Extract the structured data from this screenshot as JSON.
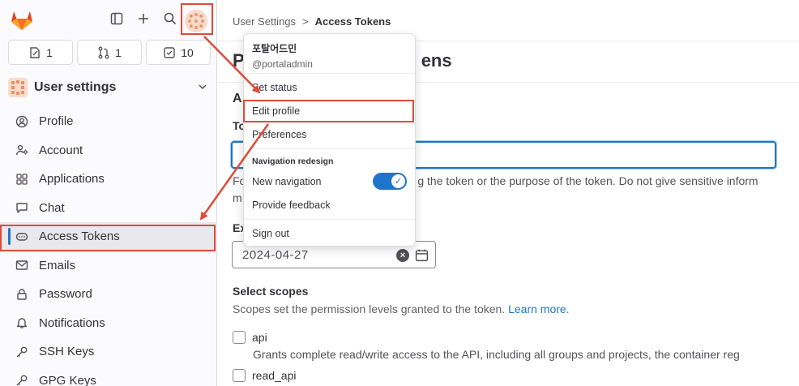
{
  "sidebar": {
    "counters": [
      {
        "icon": "issues-icon",
        "count": "1"
      },
      {
        "icon": "merge-request-icon",
        "count": "1"
      },
      {
        "icon": "todo-icon",
        "count": "10"
      }
    ],
    "section_title": "User settings",
    "items": [
      {
        "label": "Profile",
        "icon": "profile-icon"
      },
      {
        "label": "Account",
        "icon": "account-icon"
      },
      {
        "label": "Applications",
        "icon": "applications-icon"
      },
      {
        "label": "Chat",
        "icon": "chat-icon"
      },
      {
        "label": "Access Tokens",
        "icon": "token-icon",
        "active": true
      },
      {
        "label": "Emails",
        "icon": "mail-icon"
      },
      {
        "label": "Password",
        "icon": "lock-icon"
      },
      {
        "label": "Notifications",
        "icon": "bell-icon"
      },
      {
        "label": "SSH Keys",
        "icon": "key-icon"
      },
      {
        "label": "GPG Keys",
        "icon": "key-icon"
      }
    ]
  },
  "breadcrumb": {
    "parent": "User Settings",
    "separator": ">",
    "current": "Access Tokens"
  },
  "main": {
    "title_left": "P",
    "title_right": "ens",
    "subtitle_left": "A",
    "token_label": "To",
    "help_line1_left": "Fo",
    "help_line1_right": "g the token or the purpose of the token. Do not give sensitive inform",
    "help_line2": "m",
    "expiry_label": "Ex",
    "expiry_value": "2024-04-27",
    "scopes_title": "Select scopes",
    "scopes_desc": "Scopes set the permission levels granted to the token.",
    "scopes_link": "Learn more.",
    "scopes": [
      {
        "name": "api",
        "desc": "Grants complete read/write access to the API, including all groups and projects, the container reg"
      },
      {
        "name": "read_api",
        "desc": ""
      }
    ]
  },
  "dropdown": {
    "user_name": "포탈어드민",
    "user_handle": "@portaladmin",
    "set_status": "Set status",
    "edit_profile": "Edit profile",
    "preferences": "Preferences",
    "group_label": "Navigation redesign",
    "new_navigation": "New navigation",
    "new_navigation_on": true,
    "provide_feedback": "Provide feedback",
    "sign_out": "Sign out"
  },
  "colors": {
    "accent": "#1f75cb",
    "highlight": "#dd4b39",
    "logo": "#e24329"
  }
}
